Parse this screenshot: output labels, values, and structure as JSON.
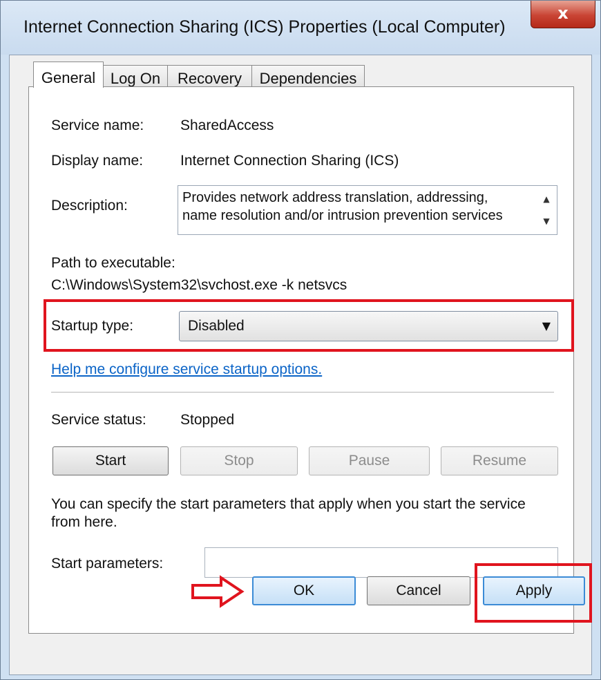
{
  "window": {
    "title": "Internet Connection Sharing (ICS) Properties (Local Computer)",
    "close_glyph": "x"
  },
  "tabs": [
    {
      "label": "General",
      "active": true
    },
    {
      "label": "Log On",
      "active": false
    },
    {
      "label": "Recovery",
      "active": false
    },
    {
      "label": "Dependencies",
      "active": false
    }
  ],
  "general": {
    "service_name_label": "Service name:",
    "service_name_value": "SharedAccess",
    "display_name_label": "Display name:",
    "display_name_value": "Internet Connection Sharing (ICS)",
    "description_label": "Description:",
    "description_value": "Provides network address translation, addressing,\nname resolution and/or intrusion prevention services",
    "path_label": "Path to executable:",
    "path_value": "C:\\Windows\\System32\\svchost.exe -k netsvcs",
    "startup_type_label": "Startup type:",
    "startup_type_value": "Disabled",
    "help_link": "Help me configure service startup options.",
    "service_status_label": "Service status:",
    "service_status_value": "Stopped",
    "buttons": {
      "start": "Start",
      "stop": "Stop",
      "pause": "Pause",
      "resume": "Resume"
    },
    "start_params_info": "You can specify the start parameters that apply when you start the service\nfrom here.",
    "start_params_label": "Start parameters:",
    "start_params_value": ""
  },
  "footer": {
    "ok": "OK",
    "cancel": "Cancel",
    "apply": "Apply"
  },
  "annotations": {
    "highlight_color": "#e0141e",
    "arrow_icon": "right-arrow-icon"
  }
}
